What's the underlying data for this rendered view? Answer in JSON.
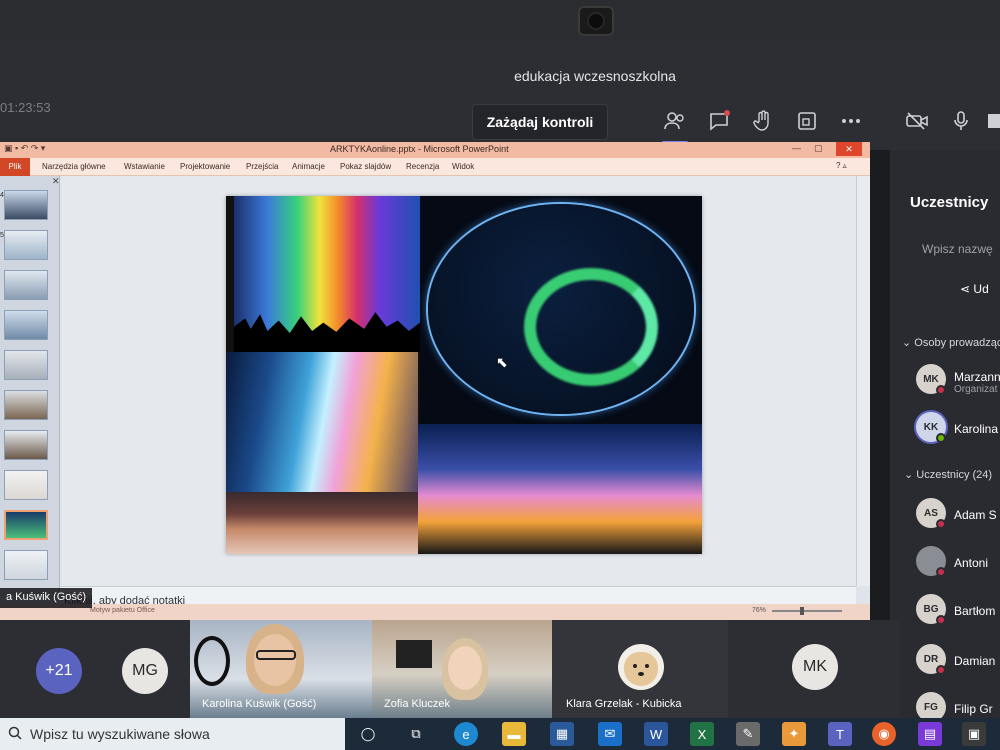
{
  "teams": {
    "meeting_title": "edukacja wczesnoszkolna",
    "timer": "01:23:53",
    "request_control": "Zażądaj kontroli"
  },
  "ppt": {
    "window_title": "ARKTYKAonline.pptx - Microsoft PowerPoint",
    "tabs": [
      "Plik",
      "Narzędzia główne",
      "Wstawianie",
      "Projektowanie",
      "Przejścia",
      "Animacje",
      "Pokaz slajdów",
      "Recenzja",
      "Widok"
    ],
    "notes_placeholder": "Kliknij, aby dodać notatki",
    "status": "Motyw pakietu Office",
    "zoom": "76%",
    "thumb_numbers": [
      "4",
      "5"
    ]
  },
  "panel": {
    "title": "Uczestnicy",
    "search_placeholder": "Wpisz nazwę",
    "share": "Ud",
    "organizers_label": "Osoby prowadzące",
    "participants_label": "Uczestnicy (24)",
    "organizers": [
      {
        "initials": "MK",
        "name": "Marzanna",
        "role": "Organizat"
      },
      {
        "initials": "KK",
        "name": "Karolina"
      }
    ],
    "participants": [
      {
        "initials": "AS",
        "name": "Adam S"
      },
      {
        "initials": "",
        "name": "Antoni"
      },
      {
        "initials": "BG",
        "name": "Bartłom"
      },
      {
        "initials": "DR",
        "name": "Damian"
      },
      {
        "initials": "FG",
        "name": "Filip Gr"
      }
    ]
  },
  "gallery": {
    "overflow": "+21",
    "mg_initials": "MG",
    "mk_initials": "MK",
    "name_tag": "a Kuświk (Gość)",
    "tiles": [
      {
        "name": "Karolina Kuświk (Gość)"
      },
      {
        "name": "Zofia Kluczek"
      },
      {
        "name": "Klara Grzelak - Kubicka"
      }
    ]
  },
  "taskbar": {
    "search_placeholder": "Wpisz tu wyszukiwane słowa"
  },
  "colors": {
    "teams_bg": "#2d2e33",
    "accent": "#7b83eb",
    "ppt_accent": "#d24726"
  }
}
